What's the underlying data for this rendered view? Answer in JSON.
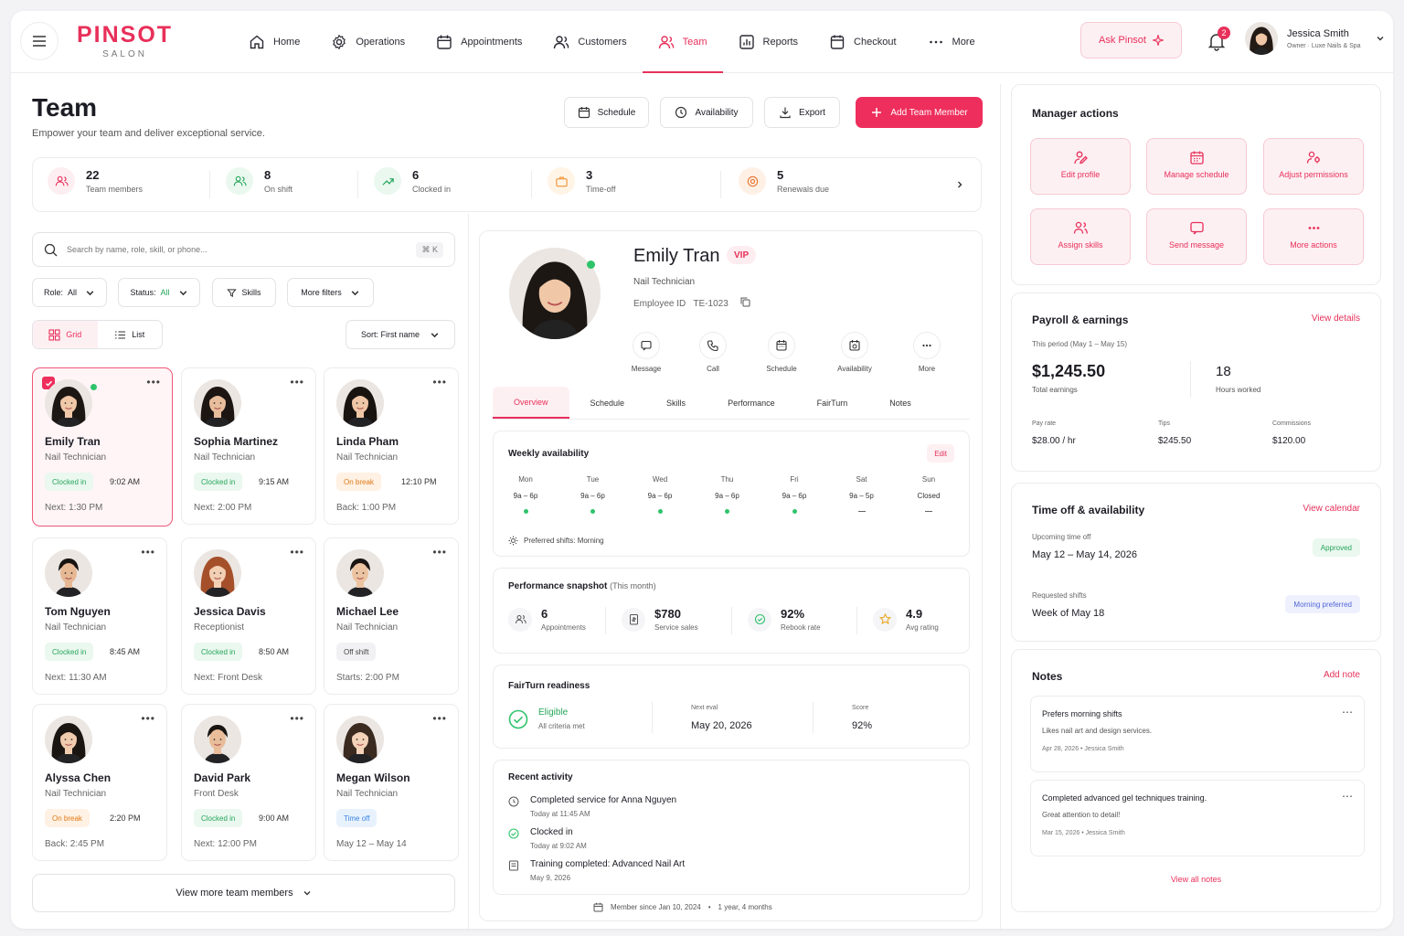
{
  "brand": {
    "name": "PINSOT",
    "tag": "SALON"
  },
  "nav": [
    {
      "label": "Home",
      "icon": "home-icon"
    },
    {
      "label": "Operations",
      "icon": "gear-icon"
    },
    {
      "label": "Appointments",
      "icon": "calendar-icon"
    },
    {
      "label": "Customers",
      "icon": "customers-icon"
    },
    {
      "label": "Team",
      "icon": "team-icon",
      "active": true
    },
    {
      "label": "Reports",
      "icon": "reports-icon"
    },
    {
      "label": "Checkout",
      "icon": "checkout-icon"
    },
    {
      "label": "More",
      "icon": "more-icon"
    }
  ],
  "ask": "Ask Pinsot",
  "notif_count": "2",
  "user": {
    "name": "Jessica Smith",
    "role": "Owner · Luxe Nails & Spa"
  },
  "page": {
    "title": "Team",
    "subtitle": "Empower your team and deliver exceptional service."
  },
  "actions": {
    "schedule": "Schedule",
    "availability": "Availability",
    "export": "Export",
    "add": "Add Team Member"
  },
  "stats": [
    {
      "value": "22",
      "label": "Team members"
    },
    {
      "value": "8",
      "label": "On shift"
    },
    {
      "value": "6",
      "label": "Clocked in"
    },
    {
      "value": "3",
      "label": "Time-off"
    },
    {
      "value": "5",
      "label": "Renewals due"
    }
  ],
  "search": {
    "placeholder": "Search by name, role, skill, or phone...",
    "shortcut": "⌘ K"
  },
  "filters": {
    "role_label": "Role:",
    "role_value": "All",
    "status_label": "Status:",
    "status_value": "All",
    "skills": "Skills",
    "more": "More filters",
    "sort": "Sort: First name"
  },
  "view": {
    "grid": "Grid",
    "list": "List"
  },
  "members": [
    {
      "name": "Emily Tran",
      "role": "Nail Technician",
      "status": "Clocked in",
      "color": "green",
      "time": "9:02 AM",
      "next": "Next:  1:30 PM",
      "selected": true,
      "online": true,
      "skin": "#f0c8a8",
      "hair": "#1d1714",
      "fem": true
    },
    {
      "name": "Sophia Martinez",
      "role": "Nail Technician",
      "status": "Clocked in",
      "color": "green",
      "time": "9:15 AM",
      "next": "Next:  2:00 PM",
      "skin": "#e8bd9c",
      "hair": "#1c1512",
      "fem": true
    },
    {
      "name": "Linda Pham",
      "role": "Nail Technician",
      "status": "On break",
      "color": "orange",
      "time": "12:10 PM",
      "next": "Back:  1:00 PM",
      "skin": "#efc6a6",
      "hair": "#191310",
      "fem": true
    },
    {
      "name": "Tom Nguyen",
      "role": "Nail Technician",
      "status": "Clocked in",
      "color": "green",
      "time": "8:45 AM",
      "next": "Next:  11:30 AM",
      "skin": "#e6b894",
      "hair": "#171311",
      "fem": false
    },
    {
      "name": "Jessica Davis",
      "role": "Receptionist",
      "status": "Clocked in",
      "color": "green",
      "time": "8:50 AM",
      "next": "Next:  Front Desk",
      "skin": "#f3cfb3",
      "hair": "#a5502a",
      "fem": true
    },
    {
      "name": "Michael Lee",
      "role": "Nail Technician",
      "status": "Off shift",
      "color": "gray",
      "time": "",
      "next": "Starts:  2:00 PM",
      "skin": "#ecc4a2",
      "hair": "#1a1512",
      "fem": false
    },
    {
      "name": "Alyssa Chen",
      "role": "Nail Technician",
      "status": "On break",
      "color": "orange",
      "time": "2:20 PM",
      "next": "Back:  2:45 PM",
      "skin": "#f1cbae",
      "hair": "#1b1512",
      "fem": true
    },
    {
      "name": "David Park",
      "role": "Front Desk",
      "status": "Clocked in",
      "color": "green",
      "time": "9:00 AM",
      "next": "Next:  12:00 PM",
      "skin": "#e9bd9a",
      "hair": "#181411",
      "fem": false
    },
    {
      "name": "Megan Wilson",
      "role": "Nail Technician",
      "status": "Time off",
      "color": "blue",
      "time": "",
      "next": "May 12 – May 14",
      "skin": "#f4d3b8",
      "hair": "#3a2a20",
      "fem": true
    }
  ],
  "view_more": "View more team members",
  "profile": {
    "name": "Emily Tran",
    "badge": "VIP",
    "role": "Nail Technician",
    "employee_id_label": "Employee ID",
    "employee_id": "TE-1023",
    "quick": [
      "Message",
      "Call",
      "Schedule",
      "Availability",
      "More"
    ],
    "tabs": [
      "Overview",
      "Schedule",
      "Skills",
      "Performance",
      "FairTurn",
      "Notes"
    ],
    "availability": {
      "title": "Weekly availability",
      "edit": "Edit",
      "days": [
        {
          "d": "Mon",
          "h": "9a – 6p",
          "on": true
        },
        {
          "d": "Tue",
          "h": "9a – 6p",
          "on": true
        },
        {
          "d": "Wed",
          "h": "9a – 6p",
          "on": true
        },
        {
          "d": "Thu",
          "h": "9a – 6p",
          "on": true
        },
        {
          "d": "Fri",
          "h": "9a – 6p",
          "on": true
        },
        {
          "d": "Sat",
          "h": "9a – 5p",
          "on": false
        },
        {
          "d": "Sun",
          "h": "Closed",
          "on": false
        }
      ],
      "pref": "Preferred shifts: Morning"
    },
    "performance": {
      "title": "Performance snapshot",
      "period": "(This month)",
      "items": [
        {
          "v": "6",
          "l": "Appointments"
        },
        {
          "v": "$780",
          "l": "Service sales"
        },
        {
          "v": "92%",
          "l": "Rebook rate"
        },
        {
          "v": "4.9",
          "l": "Avg rating"
        }
      ]
    },
    "fairturn": {
      "title": "FairTurn readiness",
      "status": "Eligible",
      "criteria": "All criteria met",
      "next_label": "Next eval",
      "next": "May 20, 2026",
      "score_label": "Score",
      "score": "92%"
    },
    "activity": {
      "title": "Recent activity",
      "items": [
        {
          "a": "Completed service for Anna Nguyen",
          "b": "Today at 11:45 AM"
        },
        {
          "a": "Clocked in",
          "b": "Today at 9:02 AM"
        },
        {
          "a": "Training completed: Advanced Nail Art",
          "b": "May 9, 2026"
        }
      ]
    },
    "member_since": "Member since Jan 10, 2024",
    "tenure": "1 year, 4 months"
  },
  "manager": {
    "title": "Manager actions",
    "buttons": [
      "Edit profile",
      "Manage schedule",
      "Adjust permissions",
      "Assign skills",
      "Send message",
      "More actions"
    ]
  },
  "payroll": {
    "title": "Payroll & earnings",
    "link": "View details",
    "period": "This period (May 1 – May 15)",
    "total": "$1,245.50",
    "total_label": "Total earnings",
    "hours": "18",
    "hours_label": "Hours worked",
    "pay_label": "Pay rate",
    "pay": "$28.00 / hr",
    "tips_label": "Tips",
    "tips": "$245.50",
    "comm_label": "Commissions",
    "comm": "$120.00"
  },
  "timeoff": {
    "title": "Time off & availability",
    "link": "View calendar",
    "up_label": "Upcoming time off",
    "up": "May 12 – May 14, 2026",
    "up_status": "Approved",
    "req_label": "Requested shifts",
    "req": "Week of May 18",
    "req_status": "Morning preferred"
  },
  "notes": {
    "title": "Notes",
    "link": "Add note",
    "items": [
      {
        "a": "Prefers morning shifts",
        "b": "Likes nail art and design services.",
        "c": "Apr 28, 2026  •  Jessica Smith"
      },
      {
        "a": "Completed advanced gel techniques training.",
        "b": "Great attention to detail!",
        "c": "Mar 15, 2026  •  Jessica Smith"
      }
    ],
    "all": "View all notes"
  },
  "colors": {
    "accent": "#e8305a",
    "green": "#2fc36b"
  }
}
